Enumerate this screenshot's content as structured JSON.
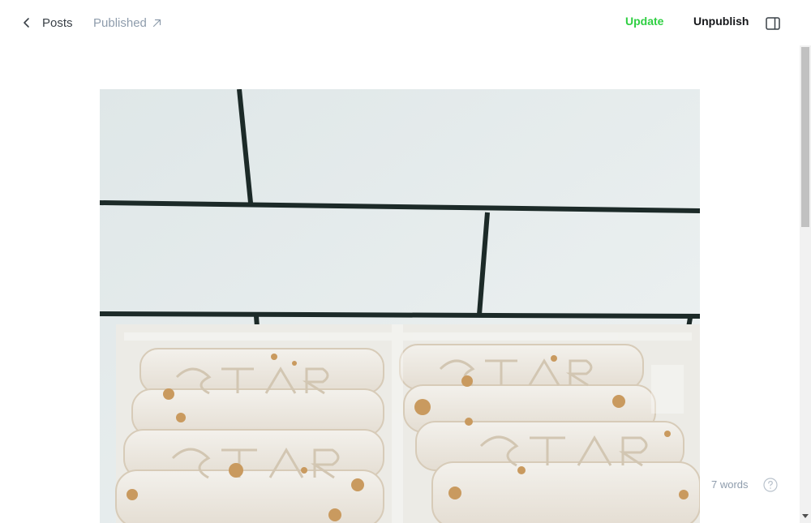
{
  "header": {
    "back_label": "Posts",
    "status_label": "Published",
    "update_label": "Update",
    "unpublish_label": "Unpublish"
  },
  "icons": {
    "back": "chevron-left-icon",
    "status": "arrow-up-right-icon",
    "sidebar": "sidebar-toggle-icon",
    "help": "help-circle-icon"
  },
  "colors": {
    "update": "#30cf43",
    "status": "#8e9cac",
    "text": "#15171a"
  },
  "footer": {
    "word_count": "7 words"
  }
}
